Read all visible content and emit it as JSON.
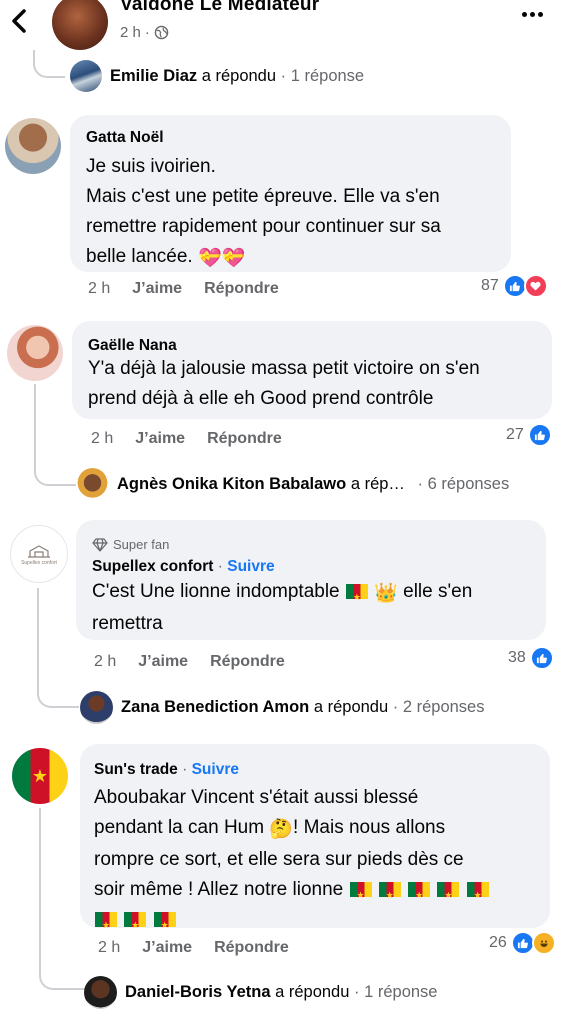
{
  "header": {
    "name": "Valdone Le Médiateur",
    "time": "2 h",
    "dot": "·"
  },
  "emojis": {
    "heart_gift": "💝",
    "crown": "👑",
    "thinking": "🤔"
  },
  "thread": {
    "reply1": {
      "name": "Emilie Diaz",
      "action": "a répondu",
      "count": "· 1 réponse"
    },
    "c1": {
      "author": "Gatta Noël",
      "lines": [
        "Je suis ivoirien.",
        "Mais c'est une petite épreuve. Elle va s'en",
        "remettre rapidement pour continuer sur sa",
        "belle lancée."
      ],
      "time": "2 h",
      "like": "J’aime",
      "reply": "Répondre",
      "reactions": "87"
    },
    "c2": {
      "author": "Gaëlle Nana",
      "lines": [
        "Y'a déjà la jalousie massa petit victoire on s'en",
        "prend déjà à elle eh Good prend contrôle"
      ],
      "time": "2 h",
      "like": "J’aime",
      "reply": "Répondre",
      "reactions": "27"
    },
    "reply2": {
      "name": "Agnès Onika Kiton Babalawo",
      "action": "a rép…",
      "count": "· 6 réponses"
    },
    "c3": {
      "badge": "Super fan",
      "author": "Supellex confort",
      "sep": "·",
      "follow": "Suivre",
      "line1a": "C'est Une lionne indomptable",
      "line1b": "elle s'en",
      "line2": "remettra",
      "time": "2 h",
      "like": "J’aime",
      "reply": "Répondre",
      "reactions": "38",
      "logo_text": "Supellex confort"
    },
    "reply3": {
      "name": "Zana Benediction Amon",
      "action": "a répondu",
      "count": "· 2 réponses"
    },
    "c4": {
      "author": "Sun's trade",
      "sep": "·",
      "follow": "Suivre",
      "line1": "Aboubakar Vincent s'était aussi blessé",
      "line2a": "pendant la can Hum",
      "line2b": "! Mais nous allons",
      "line3": "rompre ce sort, et elle sera sur pieds dès ce",
      "line4": "soir même ! Allez notre lionne",
      "time": "2 h",
      "like": "J’aime",
      "reply": "Répondre",
      "reactions": "26"
    },
    "reply4": {
      "name": "Daniel-Boris Yetna",
      "action": "a répondu",
      "count": "· 1 réponse"
    }
  },
  "colors": {
    "link": "#1877f2",
    "bubble": "#f0f2f5",
    "muted": "#65676b"
  }
}
